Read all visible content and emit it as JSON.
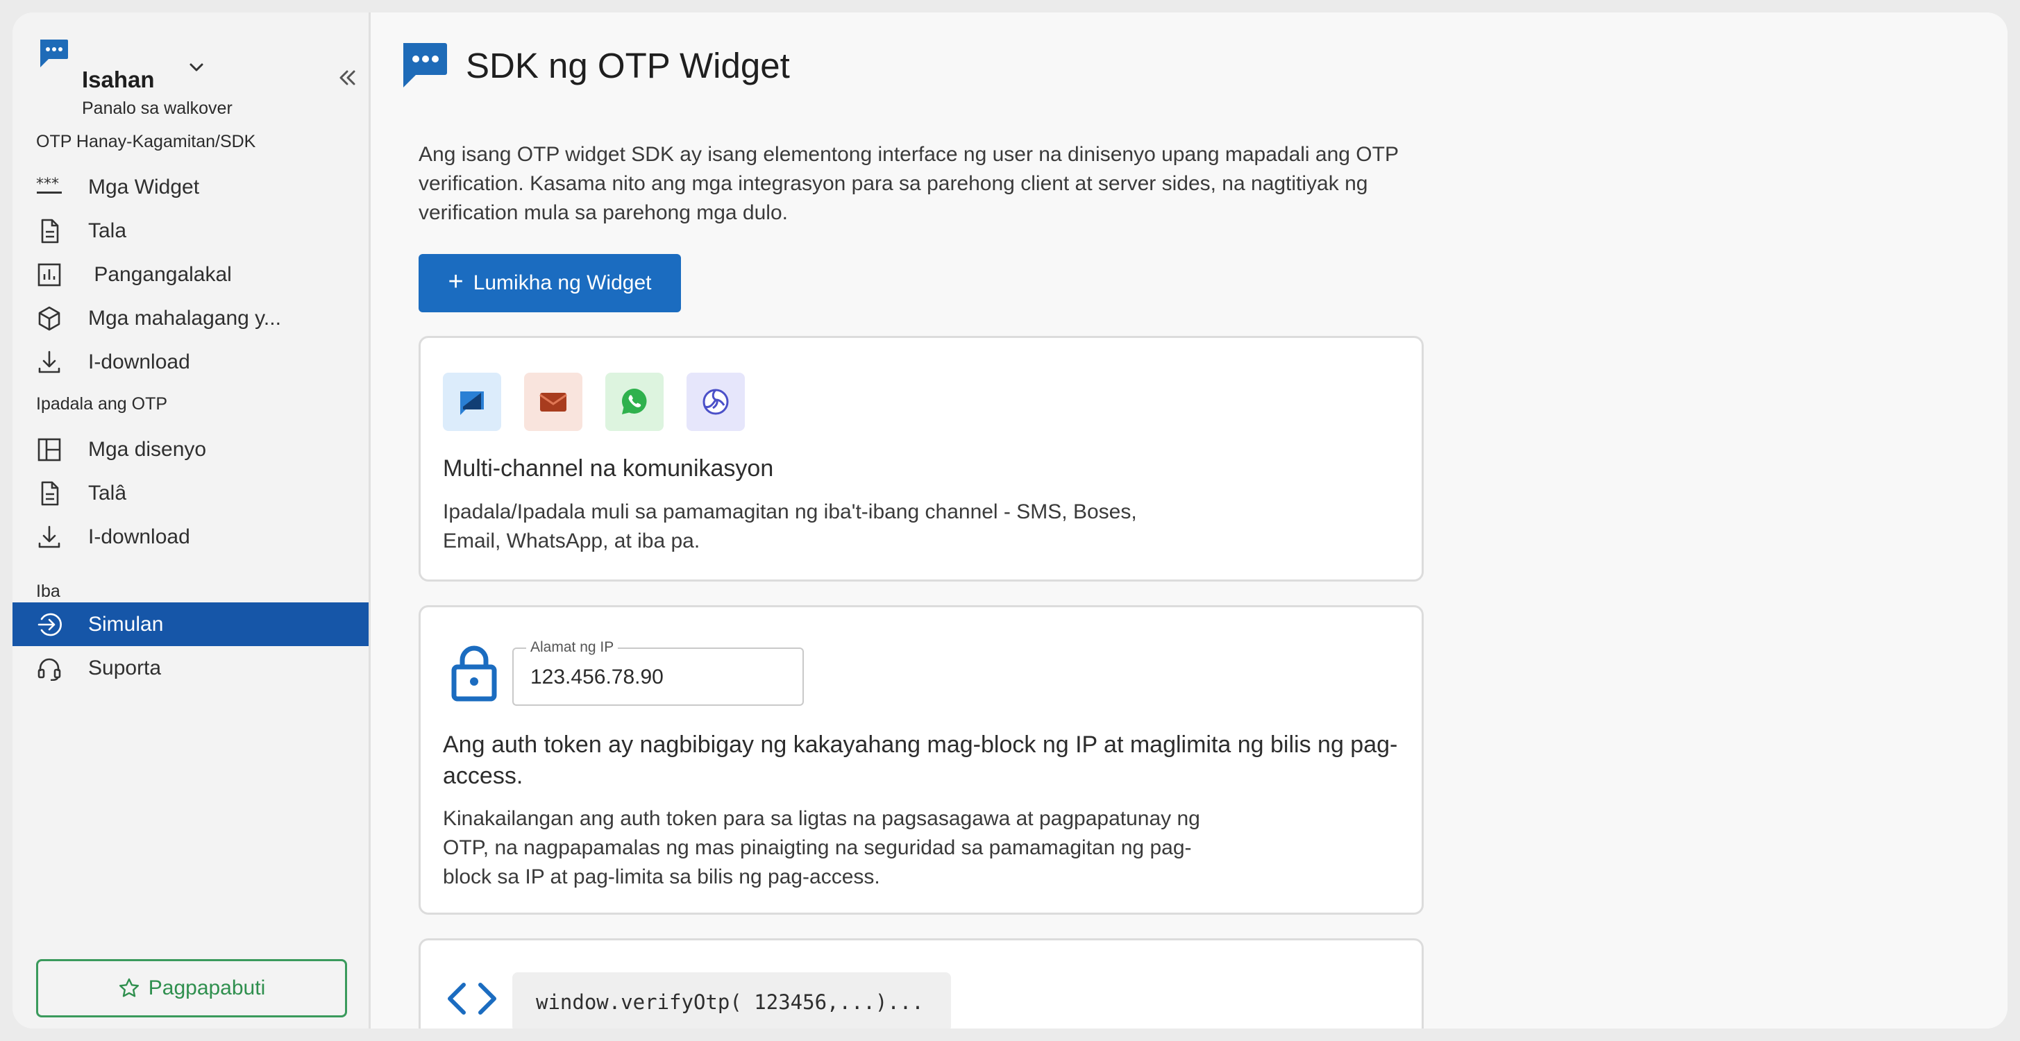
{
  "workspace": {
    "name": "Isahan",
    "subtitle": "Panalo sa walkover"
  },
  "sidebar": {
    "sections": [
      {
        "title": "OTP Hanay-Kagamitan/SDK",
        "items": [
          {
            "label": "Mga Widget",
            "icon": "asterisk-dots-icon"
          },
          {
            "label": "Tala",
            "icon": "document-icon"
          },
          {
            "label": " Pangangalakal",
            "icon": "bar-chart-icon"
          },
          {
            "label": "Mga mahalagang y...",
            "icon": "cube-icon"
          },
          {
            "label": "I-download",
            "icon": "download-icon"
          }
        ]
      },
      {
        "title": "Ipadala ang OTP",
        "items": [
          {
            "label": "Mga disenyo",
            "icon": "layout-icon"
          },
          {
            "label": "Talâ",
            "icon": "document-icon"
          },
          {
            "label": "I-download",
            "icon": "download-icon"
          }
        ]
      },
      {
        "title": "Iba",
        "items": [
          {
            "label": "Simulan",
            "icon": "circle-arrow-icon",
            "active": true
          },
          {
            "label": "Suporta",
            "icon": "headset-icon"
          }
        ]
      }
    ],
    "improve_label": "Pagpapabuti"
  },
  "header": {
    "title": "SDK ng OTP Widget"
  },
  "main": {
    "intro": "Ang isang OTP widget SDK ay isang elementong interface ng user na dinisenyo upang mapadali ang OTP verification. Kasama nito ang mga integrasyon para sa parehong client at server sides, na nagtitiyak ng verification mula sa parehong mga dulo.",
    "create_button": "Lumikha ng Widget",
    "cards": {
      "channels": {
        "title": "Multi-channel na komunikasyon",
        "desc": "Ipadala/Ipadala muli sa pamamagitan ng iba't-ibang channel - SMS, Boses, Email, WhatsApp, at iba pa."
      },
      "auth": {
        "ip_legend": "Alamat ng IP",
        "ip_value": "123.456.78.90",
        "title": "Ang auth token ay nagbibigay ng kakayahang mag-block ng IP at maglimita ng bilis ng pag-access.",
        "desc": "Kinakailangan ang auth token para sa ligtas na pagsasagawa at pagpapatunay ng OTP, na nagpapamalas ng mas pinaigting na seguridad sa pamamagitan ng pag-block sa IP at pag-limita sa bilis ng pag-access."
      },
      "code": {
        "snippet": "window.verifyOtp( 123456,...)..."
      }
    }
  },
  "colors": {
    "accent": "#1b6cc0",
    "active_nav": "#1656a8",
    "improve": "#2f8f4e"
  }
}
